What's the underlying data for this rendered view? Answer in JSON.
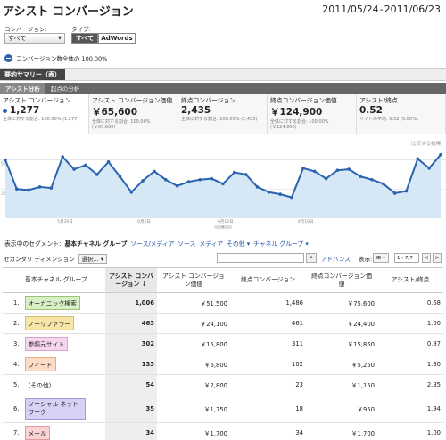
{
  "page": {
    "title": "アシスト コンバージョン",
    "date_start": "2011/05/24",
    "date_sep": "-",
    "date_end": "2011/06/23"
  },
  "filters": {
    "conversion_label": "コンバージョン:",
    "conversion_value": "すべて",
    "type_label": "タイプ:",
    "type_options": [
      "すべて",
      "AdWords"
    ]
  },
  "summary_line": "コンバージョン数全体の 100.00%",
  "report": {
    "title": "要約サマリー（表）",
    "tabs": [
      "アシスト分析",
      "起点の分析"
    ]
  },
  "metrics": [
    {
      "name": "アシスト コンバージョン",
      "value": "1,277",
      "desc": "全体に対する割合: 100.00% (1,277)"
    },
    {
      "name": "アシスト コンバージョン価値",
      "value": "￥65,600",
      "desc": "全体に対する割合: 100.00% (￥65,600)"
    },
    {
      "name": "終点コンバージョン",
      "value": "2,435",
      "desc": "全体に対する割合: 100.00% (2,435)"
    },
    {
      "name": "終点コンバージョン価値",
      "value": "￥124,900",
      "desc": "全体に対する割合: 100.00% (￥124,900)"
    },
    {
      "name": "アシスト/終点",
      "value": "0.52",
      "desc": "サイトの平均: 0.52 (0.00%)"
    }
  ],
  "compare_label": "比較する指標",
  "chart_data": {
    "type": "area",
    "y_tick_labels": [
      "56",
      "28"
    ],
    "x_tick_labels": [
      "5月29日",
      "6月5日",
      "6月12日",
      "6月19日"
    ],
    "series": [
      {
        "name": "アシスト コンバージョン",
        "values": [
          56,
          28,
          27,
          30,
          29,
          59,
          47,
          51,
          42,
          54,
          40,
          25,
          36,
          45,
          37,
          31,
          35,
          37,
          38,
          33,
          44,
          42,
          30,
          25,
          23,
          20,
          48,
          45,
          38,
          46,
          47,
          40,
          37,
          33,
          24,
          26,
          57,
          48,
          61
        ]
      }
    ],
    "ylim": [
      0,
      65
    ],
    "grid": true,
    "color": "#2a64b0",
    "fill": "#d6e8f5"
  },
  "segments": {
    "label": "表示中のセグメント:",
    "current": "基本チャネル グループ",
    "links": [
      "ソース/メディア",
      "ソース",
      "メディア",
      "その他 ▾",
      "チャネル グループ ▾"
    ]
  },
  "toolbar": {
    "secondary_dim": "セカンダリ ディメンション",
    "select": "選択... ▾",
    "search_icon": "search-icon",
    "advanced": "アドバンス",
    "display": "表示:",
    "view": "⊞ ▾",
    "range": "1 - 7/7",
    "prev": "<",
    "next": ">"
  },
  "table": {
    "headers": [
      "基本チャネル グループ",
      "アシスト コンバージョン",
      "アシスト コンバージョン価値",
      "終点コンバージョン",
      "終点コンバージョン価値",
      "アシスト/終点"
    ],
    "sort_arrow": "↓",
    "rows": [
      {
        "idx": "1.",
        "name": "オーガニック検索",
        "chip": "#d9f0c6",
        "border": "#9bc47a",
        "ac": "1,006",
        "acv": "￥51,500",
        "lc": "1,486",
        "lcv": "￥75,600",
        "ratio": "0.68"
      },
      {
        "idx": "2.",
        "name": "ノーリファラー",
        "chip": "#f6e5a6",
        "border": "#d6bf6c",
        "ac": "463",
        "acv": "￥24,100",
        "lc": "461",
        "lcv": "￥24,400",
        "ratio": "1.00"
      },
      {
        "idx": "3.",
        "name": "参照元サイト",
        "chip": "#f6d6ee",
        "border": "#d9a3ca",
        "ac": "302",
        "acv": "￥15,800",
        "lc": "311",
        "lcv": "￥15,850",
        "ratio": "0.97"
      },
      {
        "idx": "4.",
        "name": "フィード",
        "chip": "#fbdcc7",
        "border": "#e4ac86",
        "ac": "133",
        "acv": "￥6,800",
        "lc": "102",
        "lcv": "￥5,250",
        "ratio": "1.30"
      },
      {
        "idx": "5.",
        "name": "（その他）",
        "chip": "",
        "border": "",
        "ac": "54",
        "acv": "￥2,800",
        "lc": "23",
        "lcv": "￥1,150",
        "ratio": "2.35"
      },
      {
        "idx": "6.",
        "name": "ソーシャル ネット ワーク",
        "chip": "#d8d0f5",
        "border": "#a598d8",
        "ac": "35",
        "acv": "￥1,750",
        "lc": "18",
        "lcv": "￥950",
        "ratio": "1.94"
      },
      {
        "idx": "7.",
        "name": "メール",
        "chip": "#fad4d4",
        "border": "#e29a9a",
        "ac": "34",
        "acv": "￥1,700",
        "lc": "34",
        "lcv": "￥1,700",
        "ratio": "1.00"
      }
    ]
  }
}
